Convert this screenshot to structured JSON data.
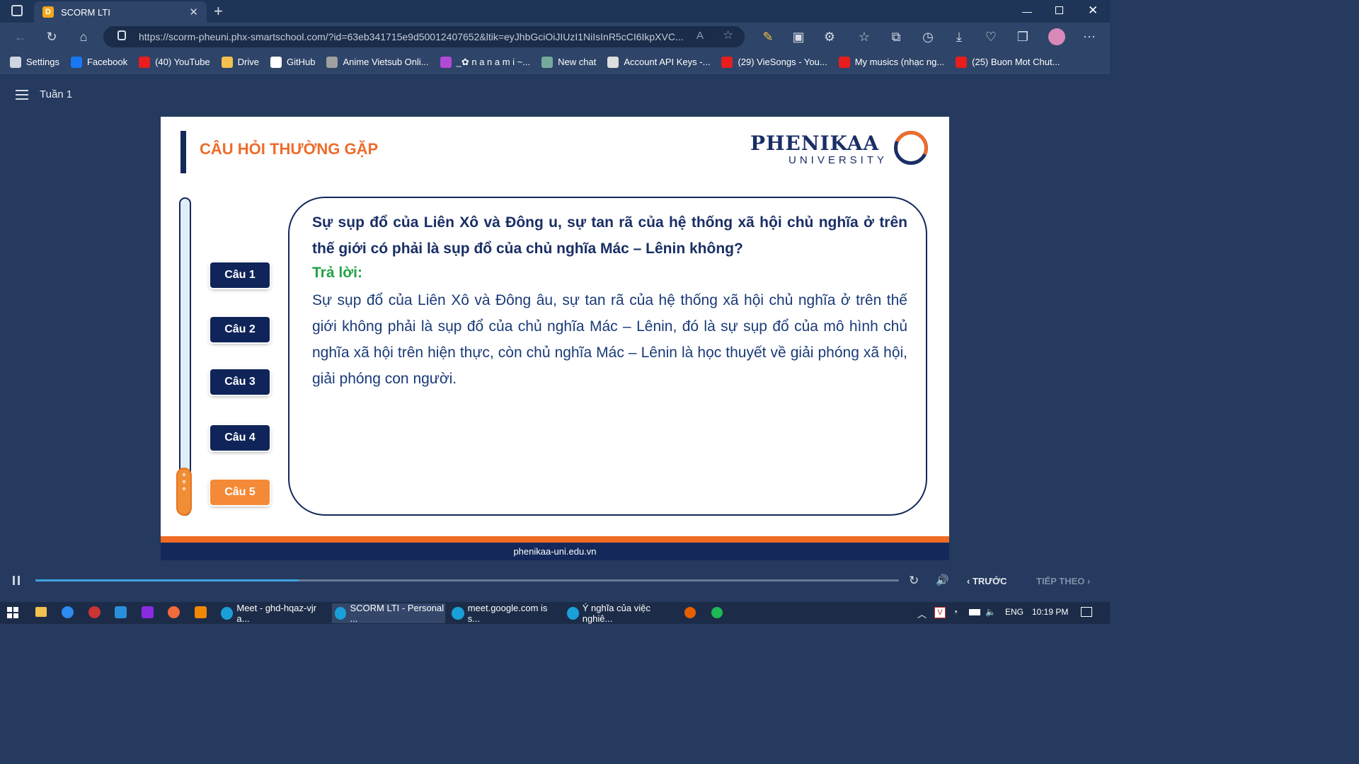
{
  "browser": {
    "tab_title": "SCORM LTI",
    "url": "https://scorm-pheuni.phx-smartschool.com/?id=63eb341715e9d50012407652&ltik=eyJhbGciOiJIUzI1NiIsInR5cCI6IkpXVC...",
    "bookmarks": [
      {
        "label": "Settings",
        "icon": "gear-icon",
        "color": "#cfd6e2"
      },
      {
        "label": "Facebook",
        "icon": "facebook-icon",
        "color": "#1877f2"
      },
      {
        "label": "(40) YouTube",
        "icon": "youtube-icon",
        "color": "#e61e1e"
      },
      {
        "label": "Drive",
        "icon": "folder-icon",
        "color": "#f2c14e"
      },
      {
        "label": "GitHub",
        "icon": "github-icon",
        "color": "#ffffff"
      },
      {
        "label": "Anime Vietsub Onli...",
        "icon": "anime-icon",
        "color": "#a0a0a0"
      },
      {
        "label": "_✿ n a n a m i ~...",
        "icon": "nanami-icon",
        "color": "#b14ad6"
      },
      {
        "label": "New chat",
        "icon": "chatgpt-icon",
        "color": "#74aa9c"
      },
      {
        "label": "Account API Keys -...",
        "icon": "openai-icon",
        "color": "#dddddd"
      },
      {
        "label": "(29) VieSongs - You...",
        "icon": "youtube-icon",
        "color": "#e61e1e"
      },
      {
        "label": "My musics (nhạc ng...",
        "icon": "youtube-icon",
        "color": "#e61e1e"
      },
      {
        "label": "(25) Buon Mot Chut...",
        "icon": "youtube-icon",
        "color": "#e61e1e"
      }
    ]
  },
  "page": {
    "week_title": "Tuần 1"
  },
  "slide": {
    "title": "CÂU HỎI THƯỜNG GẶP",
    "logo_main": "PHENIKAA",
    "logo_sub": "UNIVERSITY",
    "questions": [
      "Câu 1",
      "Câu 2",
      "Câu 3",
      "Câu 4",
      "Câu 5"
    ],
    "active_question": "Câu 5",
    "question_text": "Sự sụp đổ của Liên Xô và Đông  u, sự tan rã của hệ thống xã hội chủ nghĩa ở trên thế giới có phải là sụp đổ của chủ nghĩa Mác – Lênin không?",
    "answer_label": "Trả lời:",
    "answer_text": "Sự sụp đổ của Liên Xô và Đông âu, sự tan rã của hệ thống xã hội chủ nghĩa ở trên thế giới không phải là sụp đổ của chủ nghĩa Mác – Lênin, đó là sự sụp đổ của mô hình chủ nghĩa xã hội trên hiện thực, còn chủ nghĩa Mác – Lênin là học thuyết về giải phóng xã hội, giải phóng con người.",
    "footer": "phenikaa-uni.edu.vn",
    "accent_orange": "#f06c26",
    "accent_navy": "#14285a"
  },
  "player": {
    "progress": 0.305,
    "prev_label": "TRƯỚC",
    "next_label": "TIẾP THEO"
  },
  "taskbar": {
    "windows": [
      {
        "label": "Meet - ghd-hqaz-vjr a...",
        "icon": "edge-icon"
      },
      {
        "label": "SCORM LTI - Personal ...",
        "icon": "edge-icon"
      },
      {
        "label": "meet.google.com is s...",
        "icon": "edge-icon"
      },
      {
        "label": "Ý nghĩa của việc nghiê...",
        "icon": "edge-icon"
      }
    ],
    "language": "ENG",
    "time": "10:19 PM"
  }
}
